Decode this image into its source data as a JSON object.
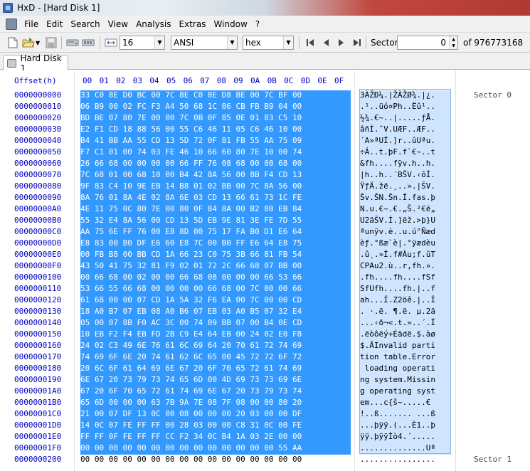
{
  "window": {
    "title": "HxD - [Hard Disk 1]"
  },
  "menu": {
    "items": [
      "File",
      "Edit",
      "Search",
      "View",
      "Analysis",
      "Extras",
      "Window",
      "?"
    ]
  },
  "toolbar": {
    "icons": [
      "new-icon",
      "open-icon",
      "save-icon",
      "disk-icon",
      "ram-icon"
    ],
    "bytes_per_row": "16",
    "charset": "ANSI",
    "offset_base": "hex",
    "sector_label": "Sector",
    "sector_value": "0",
    "sector_total": "of 976773168"
  },
  "tabs": [
    {
      "label": "Hard Disk 1"
    }
  ],
  "editor": {
    "offset_header": "Offset(h)",
    "column_headers": [
      "00",
      "01",
      "02",
      "03",
      "04",
      "05",
      "06",
      "07",
      "08",
      "09",
      "0A",
      "0B",
      "0C",
      "0D",
      "0E",
      "0F"
    ],
    "rows": [
      {
        "offset": "0000000000",
        "hex": "33 C0 8E D0 BC 00 7C 8E C0 8E D8 BE 00 7C BF 00",
        "ascii": "3ÀŽÐ¼.|ŽÀŽØ¾.|¿.",
        "note": "Sector 0"
      },
      {
        "offset": "0000000010",
        "hex": "06 B9 00 02 FC F3 A4 50 68 1C 06 CB FB B9 04 00",
        "ascii": ".¹..üó¤Ph..Ëû¹..",
        "note": ""
      },
      {
        "offset": "0000000020",
        "hex": "BD BE 07 80 7E 00 00 7C 0B 0F 85 0E 01 83 C5 10",
        "ascii": "½¾.€~..|.....ƒÅ.",
        "note": ""
      },
      {
        "offset": "0000000030",
        "hex": "E2 F1 CD 18 88 56 00 55 C6 46 11 05 C6 46 10 00",
        "ascii": "âñÍ.ˆV.UÆF..ÆF..",
        "note": ""
      },
      {
        "offset": "0000000040",
        "hex": "B4 41 BB AA 55 CD 13 5D 72 0F 81 FB 55 AA 75 09",
        "ascii": "´A»ªUÍ.]r..ûUªu.",
        "note": ""
      },
      {
        "offset": "0000000050",
        "hex": "F7 C1 01 00 74 03 FE 46 10 66 60 80 7E 10 00 74",
        "ascii": "÷Á..t.þF.f`€~..t",
        "note": ""
      },
      {
        "offset": "0000000060",
        "hex": "26 66 68 00 00 00 00 66 FF 76 08 68 00 00 68 00",
        "ascii": "&fh....fÿv.h..h.",
        "note": ""
      },
      {
        "offset": "0000000070",
        "hex": "7C 68 01 00 68 10 00 B4 42 8A 56 00 8B F4 CD 13",
        "ascii": "|h..h..´BŠV.‹ôÍ.",
        "note": ""
      },
      {
        "offset": "0000000080",
        "hex": "9F 83 C4 10 9E EB 14 B8 01 02 BB 00 7C 8A 56 00",
        "ascii": "ŸƒÄ.žë.¸..».|ŠV.",
        "note": ""
      },
      {
        "offset": "0000000090",
        "hex": "8A 76 01 8A 4E 02 8A 6E 03 CD 13 66 61 73 1C FE",
        "ascii": "Šv.ŠN.Šn.Í.fas.þ",
        "note": ""
      },
      {
        "offset": "00000000A0",
        "hex": "4E 11 75 0C 80 7E 00 80 0F 84 8A 00 B2 80 EB 84",
        "ascii": "N.u.€~.€.„Š.²€ë„",
        "note": ""
      },
      {
        "offset": "00000000B0",
        "hex": "55 32 E4 8A 56 00 CD 13 5D EB 9E 81 3E FE 7D 55",
        "ascii": "U2äŠV.Í.]ëž.>þ}U",
        "note": ""
      },
      {
        "offset": "00000000C0",
        "hex": "AA 75 6E FF 76 00 E8 8D 00 75 17 FA B0 D1 E6 64",
        "ascii": "ªunÿv.è..u.ú°Ñæd",
        "note": ""
      },
      {
        "offset": "00000000D0",
        "hex": "E8 83 00 B0 DF E6 60 E8 7C 00 B0 FF E6 64 E8 75",
        "ascii": "èƒ.°ßæ`è|.°ÿædèu",
        "note": ""
      },
      {
        "offset": "00000000E0",
        "hex": "00 FB B8 00 BB CD 1A 66 23 C0 75 3B 66 81 FB 54",
        "ascii": ".û¸.»Í.f#Àu;f.ûT",
        "note": ""
      },
      {
        "offset": "00000000F0",
        "hex": "43 50 41 75 32 81 F9 02 01 72 2C 66 68 07 BB 00",
        "ascii": "CPAu2.ù..r,fh.».",
        "note": ""
      },
      {
        "offset": "0000000100",
        "hex": "00 66 68 00 02 00 00 66 68 08 00 00 00 66 53 66",
        "ascii": ".fh....fh....fSf",
        "note": ""
      },
      {
        "offset": "0000000110",
        "hex": "53 66 55 66 68 00 00 00 00 66 68 00 7C 00 00 66",
        "ascii": "SfUfh....fh.|..f",
        "note": ""
      },
      {
        "offset": "0000000120",
        "hex": "61 68 00 00 07 CD 1A 5A 32 F6 EA 00 7C 00 00 CD",
        "ascii": "ah...Í.Z2öê.|..Í",
        "note": ""
      },
      {
        "offset": "0000000130",
        "hex": "18 A0 B7 07 EB 08 A0 B6 07 EB 03 A0 B5 07 32 E4",
        "ascii": ". ·.ë. ¶.ë. µ.2ä",
        "note": ""
      },
      {
        "offset": "0000000140",
        "hex": "05 00 07 8B F0 AC 3C 00 74 09 BB 07 00 B4 0E CD",
        "ascii": "...‹ð¬<.t.»..´.Í",
        "note": ""
      },
      {
        "offset": "0000000150",
        "hex": "10 EB F2 F4 EB FD 2B C9 E4 64 EB 00 24 02 E0 F8",
        "ascii": ".ëòôëý+Éädë.$.àø",
        "note": ""
      },
      {
        "offset": "0000000160",
        "hex": "24 02 C3 49 6E 76 61 6C 69 64 20 70 61 72 74 69",
        "ascii": "$.ÃInvalid parti",
        "note": ""
      },
      {
        "offset": "0000000170",
        "hex": "74 69 6F 6E 20 74 61 62 6C 65 00 45 72 72 6F 72",
        "ascii": "tion table.Error",
        "note": ""
      },
      {
        "offset": "0000000180",
        "hex": "20 6C 6F 61 64 69 6E 67 20 6F 70 65 72 61 74 69",
        "ascii": " loading operati",
        "note": ""
      },
      {
        "offset": "0000000190",
        "hex": "6E 67 20 73 79 73 74 65 6D 00 4D 69 73 73 69 6E",
        "ascii": "ng system.Missin",
        "note": ""
      },
      {
        "offset": "00000001A0",
        "hex": "67 20 6F 70 65 72 61 74 69 6E 67 20 73 79 73 74",
        "ascii": "g operating syst",
        "note": ""
      },
      {
        "offset": "00000001B0",
        "hex": "65 6D 00 00 00 63 7B 9A 7E 08 7F 08 00 00 80 20",
        "ascii": "em...c{š~.....€ ",
        "note": ""
      },
      {
        "offset": "00000001C0",
        "hex": "21 00 07 DF 13 0C 00 08 00 00 00 20 03 00 00 DF",
        "ascii": "!..ß....... ...ß",
        "note": ""
      },
      {
        "offset": "00000001D0",
        "hex": "14 0C 07 FE FF FF 00 28 03 00 00 C8 31 0C 00 FE",
        "ascii": "...þÿÿ.(...È1..þ",
        "note": ""
      },
      {
        "offset": "00000001E0",
        "hex": "FF FF 0F FE FF FF CC F2 34 0C B4 1A 03 2E 00 00",
        "ascii": "ÿÿ.þÿÿÌò4.´.....",
        "note": ""
      },
      {
        "offset": "00000001F0",
        "hex": "00 00 00 00 00 00 00 00 00 00 00 00 00 00 55 AA",
        "ascii": "..............Uª",
        "note": ""
      },
      {
        "offset": "0000000200",
        "hex": "00 00 00 00 00 00 00 00 00 00 00 00 00 00 00 00",
        "ascii": "................",
        "note": "Sector 1"
      }
    ],
    "selected_rows": 32
  }
}
